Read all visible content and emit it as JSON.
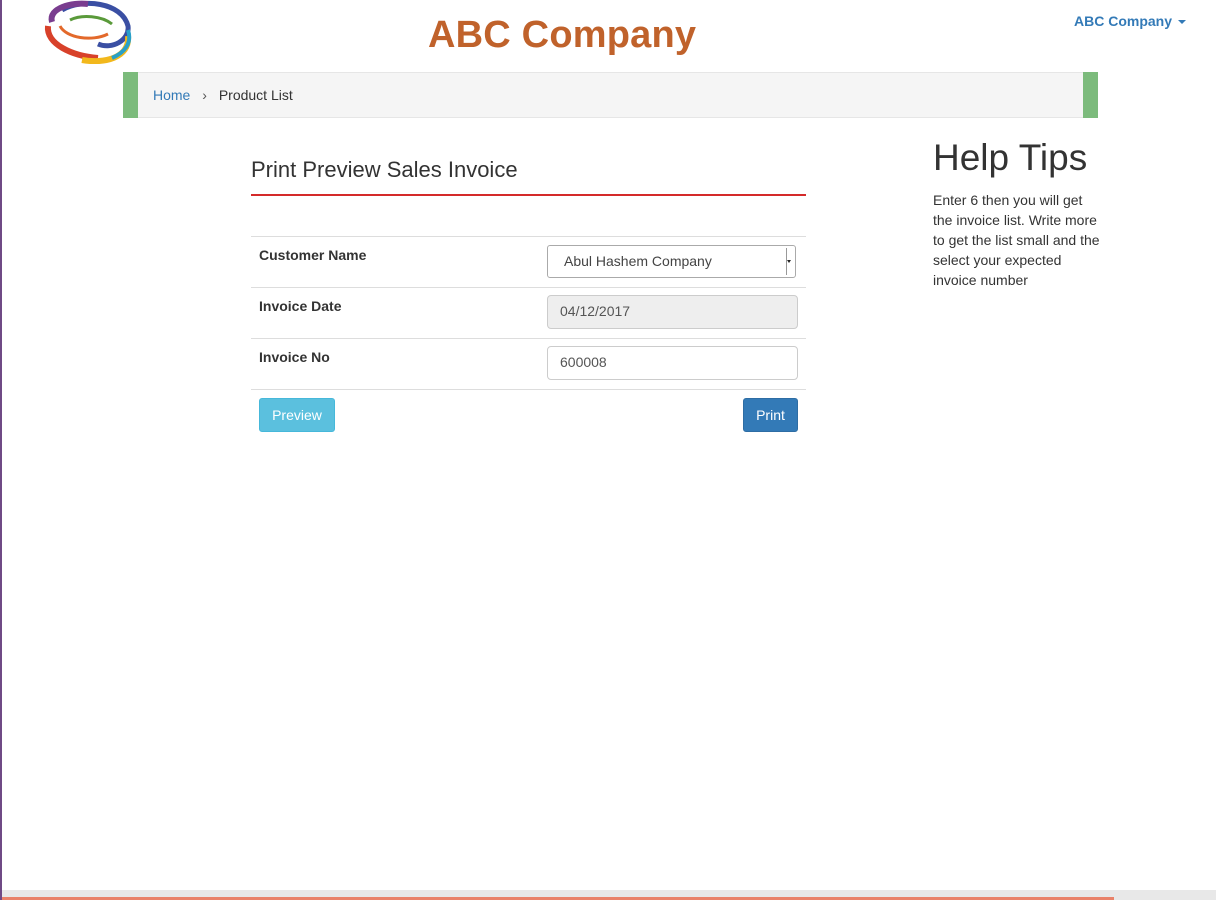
{
  "header": {
    "brand_title": "ABC Company",
    "user_menu_label": "ABC Company"
  },
  "breadcrumb": {
    "home": "Home",
    "separator": "›",
    "current": "Product List"
  },
  "form": {
    "title": "Print Preview Sales Invoice",
    "fields": {
      "customer_name_label": "Customer Name",
      "customer_name_value": "Abul Hashem Company",
      "invoice_date_label": "Invoice Date",
      "invoice_date_value": "04/12/2017",
      "invoice_no_label": "Invoice No",
      "invoice_no_value": "600008"
    },
    "buttons": {
      "preview": "Preview",
      "print": "Print"
    }
  },
  "help": {
    "title": "Help Tips",
    "text": "Enter 6 then you will get the invoice list. Write more to get the list small and the select your expected invoice number"
  },
  "colors": {
    "brand": "#c0622b",
    "link": "#337ab7",
    "breadcrumb_accent": "#7cbb7c",
    "title_underline": "#d42a2a",
    "preview_button": "#5bc0de",
    "print_button": "#337ab7"
  }
}
